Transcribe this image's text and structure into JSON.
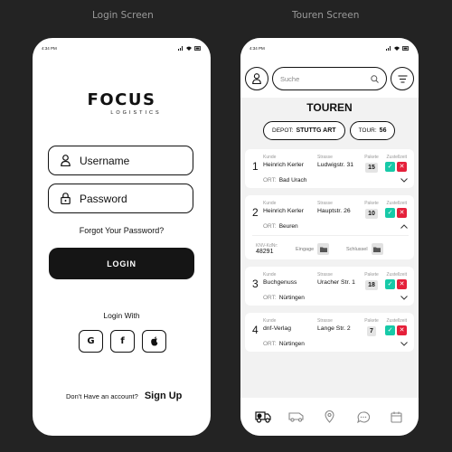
{
  "labels": {
    "login_screen": "Login Screen",
    "touren_screen": "Touren Screen"
  },
  "status_time": "4:34 PM",
  "login": {
    "logo_main": "FOCUS",
    "logo_sub": "LOGISTICS",
    "username_placeholder": "Username",
    "password_placeholder": "Password",
    "forgot": "Forgot Your Password?",
    "login_button": "LOGIN",
    "login_with": "Login With",
    "social": {
      "google": "G",
      "facebook": "f"
    },
    "no_account": "Don't Have an account?",
    "signup": "Sign Up"
  },
  "tours": {
    "search_placeholder": "Suche",
    "title": "TOUREN",
    "depot_label": "DEPOT:",
    "depot_value": "STUTTG ART",
    "tour_label": "TOUR:",
    "tour_value": "56",
    "col_kunde": "Kunde",
    "col_strasse": "Strasse",
    "col_pakete": "Pakete",
    "col_zustellzeit": "Zustellzeit",
    "ort_label": "ORT:",
    "knv_label": "KNV-KdNr:",
    "eingabe_label": "Eingage",
    "schlussel_label": "Schlussel",
    "items": [
      {
        "n": "1",
        "kunde": "Heinrich Kerler",
        "strasse": "Ludwigstr. 31",
        "pakete": "15",
        "ort": "Bad Urach"
      },
      {
        "n": "2",
        "kunde": "Heinrich Kerler",
        "strasse": "Hauptstr. 26",
        "pakete": "10",
        "ort": "Beuren",
        "knv": "48291"
      },
      {
        "n": "3",
        "kunde": "Buchgenuss",
        "strasse": "Uracher Str. 1",
        "pakete": "18",
        "ort": "Nürtingen"
      },
      {
        "n": "4",
        "kunde": "dnf-Verlag",
        "strasse": "Lange Str. 2",
        "pakete": "7",
        "ort": "Nürtingen"
      }
    ]
  },
  "colors": {
    "accent_green": "#17c9a8",
    "accent_red": "#e5203a",
    "dark": "#151515"
  }
}
